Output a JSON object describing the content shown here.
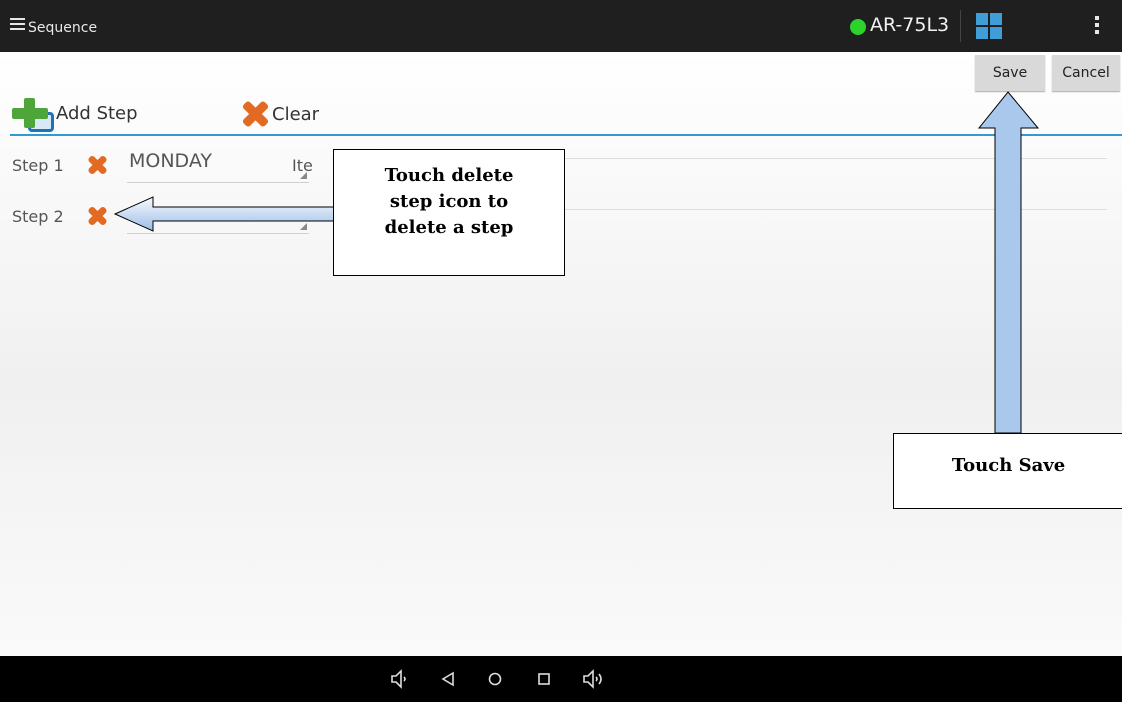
{
  "topbar": {
    "title": "Sequence",
    "device_name": "AR-75L3",
    "status_color": "#2bd32b",
    "icons": [
      "menu-icon",
      "connection-status-icon",
      "tiles-icon",
      "overflow-menu-icon"
    ]
  },
  "actions": {
    "save_label": "Save",
    "cancel_label": "Cancel",
    "add_step_label": "Add Step",
    "clear_label": "Clear"
  },
  "steps": [
    {
      "label": "Step 1",
      "value": "MONDAY",
      "item_label": "Ite"
    },
    {
      "label": "Step 2",
      "value": "",
      "item_label": ""
    }
  ],
  "callouts": {
    "delete_lines": [
      "Touch delete",
      "step icon to",
      "delete a step"
    ],
    "save_text": "Touch Save"
  },
  "colors": {
    "accent": "#2e9ad6",
    "delete": "#e26a22",
    "add": "#4ea53a",
    "arrow": "#a9c8ec"
  },
  "navbar": {
    "icons": [
      "volume-down-icon",
      "back-icon",
      "home-icon",
      "recents-icon",
      "volume-up-icon"
    ]
  }
}
